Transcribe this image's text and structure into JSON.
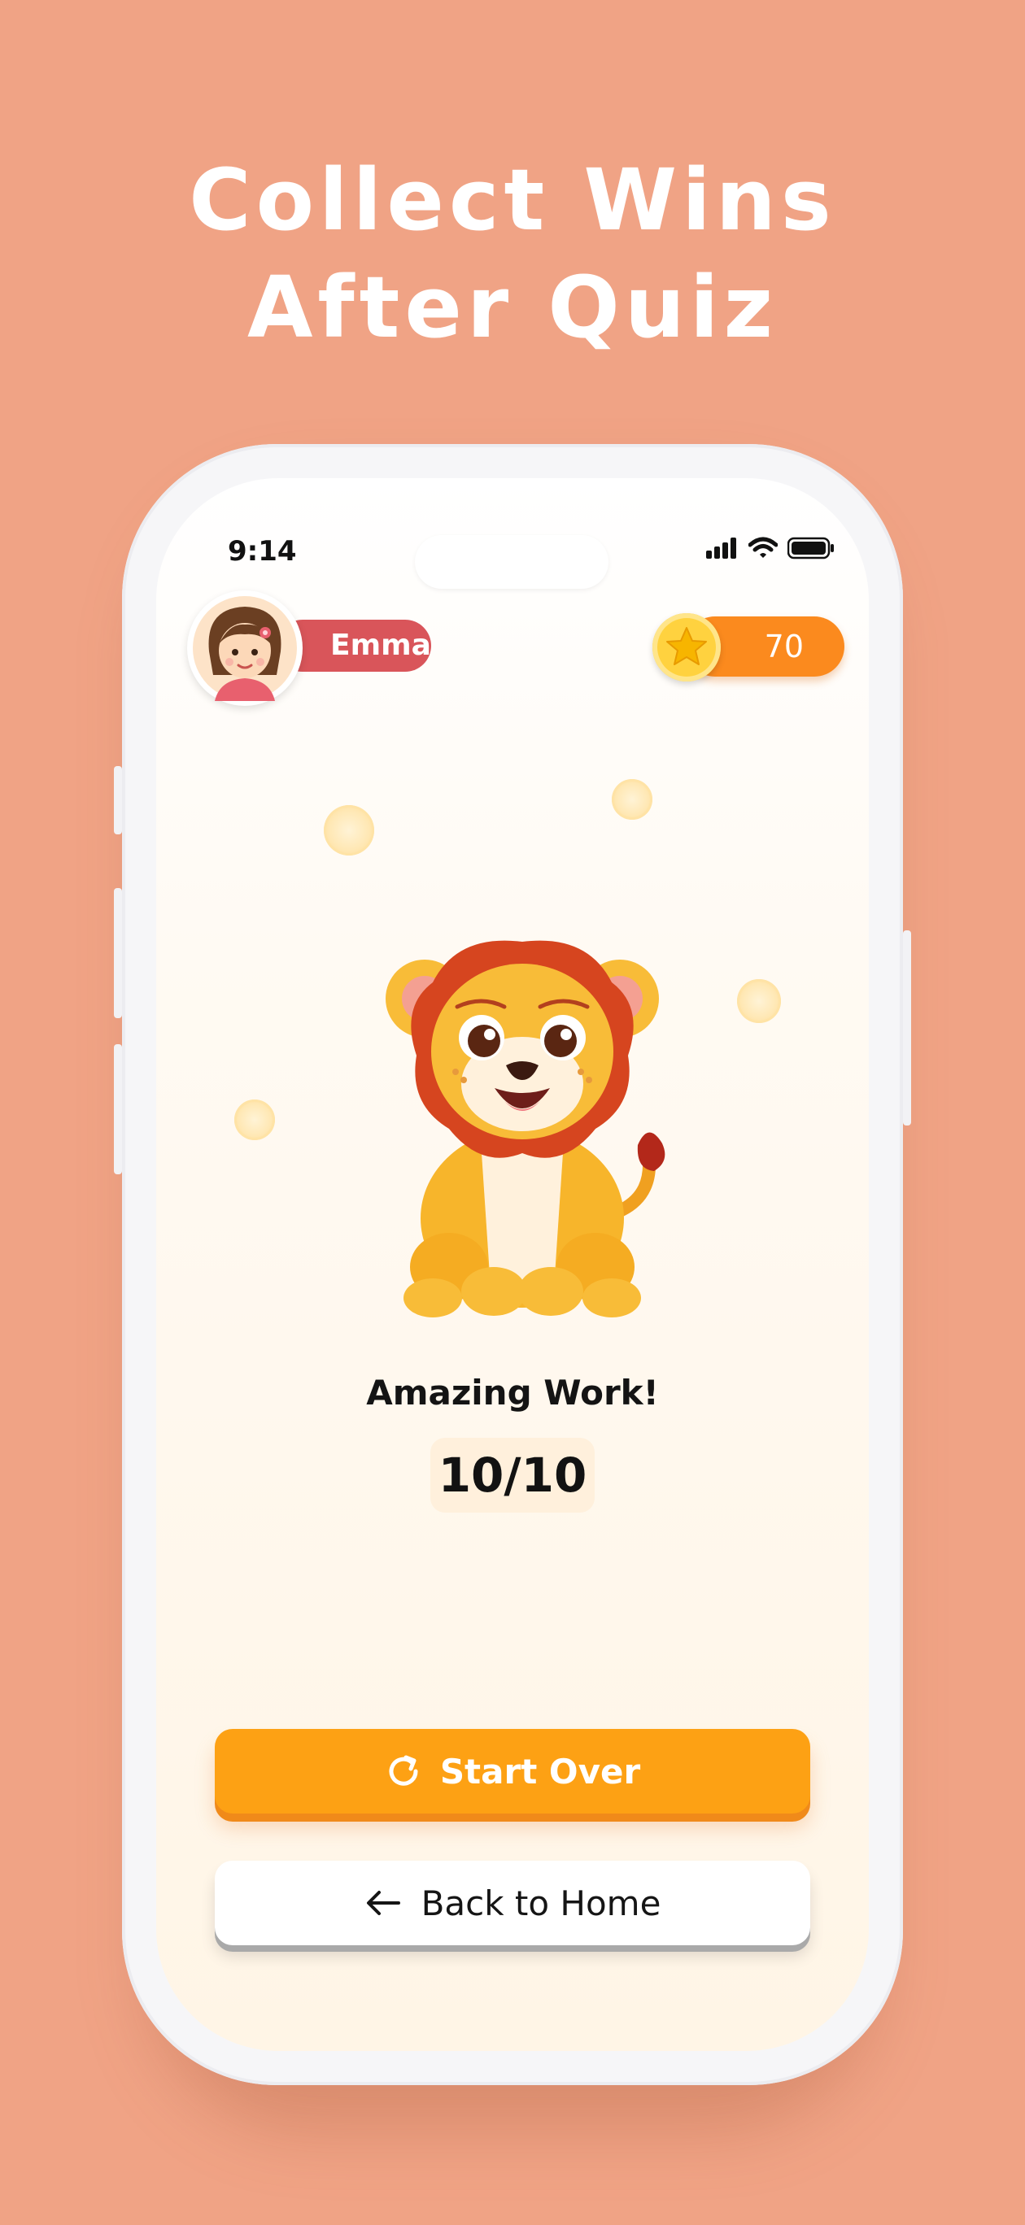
{
  "headline": {
    "line1": "Collect Wins",
    "line2": "After Quiz"
  },
  "status_bar": {
    "time": "9:14"
  },
  "profile": {
    "name": "Emma"
  },
  "coins": {
    "count": "70"
  },
  "result": {
    "message": "Amazing Work!",
    "score": "10/10"
  },
  "buttons": {
    "start_over": "Start Over",
    "back_home": "Back to Home"
  },
  "colors": {
    "background": "#F0A385",
    "name_pill": "#D9555A",
    "coin_pill": "#FB8A1E",
    "primary_button": "#FDA114"
  },
  "icons": [
    "signal-icon",
    "wifi-icon",
    "battery-icon",
    "star-coin-icon",
    "restart-icon",
    "arrow-left-icon",
    "lion-mascot"
  ]
}
